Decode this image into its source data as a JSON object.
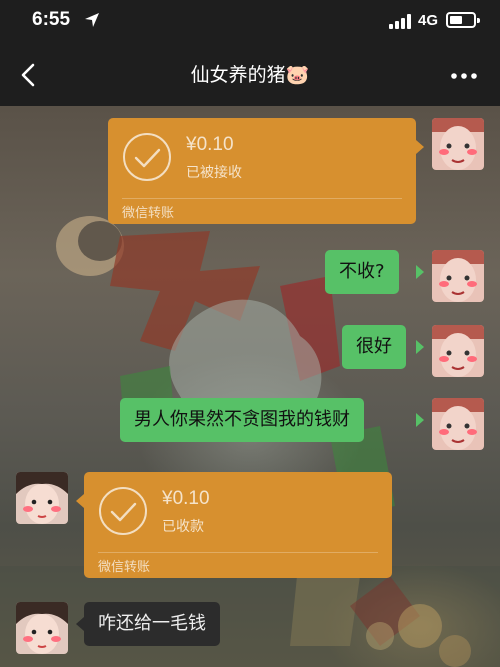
{
  "status_bar": {
    "time": "6:55",
    "network": "4G",
    "battery_fraction": 0.55
  },
  "navbar": {
    "title": "仙女养的猪🐷"
  },
  "messages": [
    {
      "from": "me",
      "type": "transfer",
      "amount": "¥0.10",
      "status": "已被接收",
      "label": "微信转账"
    },
    {
      "from": "me",
      "type": "text",
      "text": "不收?"
    },
    {
      "from": "me",
      "type": "text",
      "text": "很好"
    },
    {
      "from": "me",
      "type": "text",
      "text": "男人你果然不贪图我的钱财"
    },
    {
      "from": "them",
      "type": "transfer",
      "amount": "¥0.10",
      "status": "已收款",
      "label": "微信转账"
    },
    {
      "from": "them",
      "type": "text",
      "text": "咋还给一毛钱"
    }
  ],
  "colors": {
    "green_bubble": "#57c167",
    "transfer_orange": "#d7902f",
    "dark_bubble": "#2c2c2c",
    "nav_bg": "#1e1e1e"
  }
}
